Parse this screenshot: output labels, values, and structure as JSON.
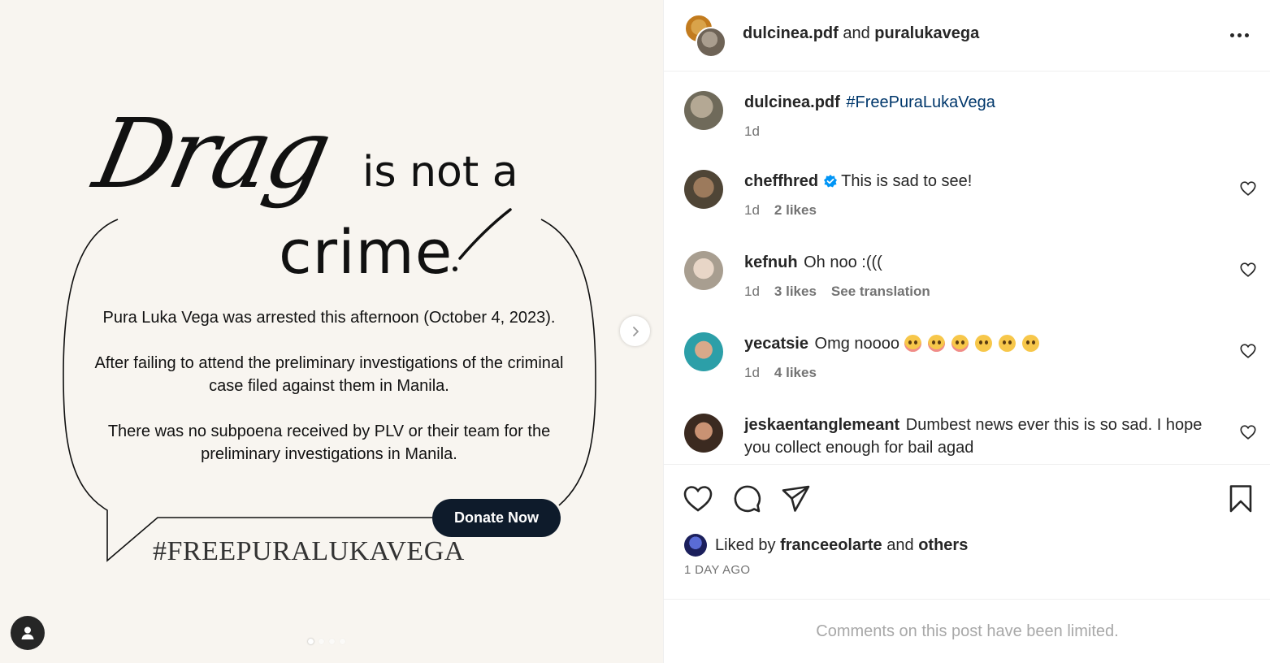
{
  "media": {
    "headline_script": "Drag",
    "headline_rest": "is not a",
    "headline_crime": "crime",
    "paragraph1": "Pura Luka Vega was arrested this afternoon (October 4, 2023).",
    "paragraph2": "After failing to attend the preliminary investigations of the criminal case filed against them in Manila.",
    "paragraph3": "There was no subpoena received by PLV or their team for the preliminary investigations in Manila.",
    "donate_label": "Donate Now",
    "hashtag": "#FREEPURALUKAVEGA",
    "carousel_total": 4,
    "carousel_active": 1
  },
  "header": {
    "user1": "dulcinea.pdf",
    "and": "and",
    "user2": "puralukavega"
  },
  "caption": {
    "user": "dulcinea.pdf",
    "text": "#FreePuraLukaVega",
    "time": "1d"
  },
  "comments": [
    {
      "user": "cheffhred",
      "verified": true,
      "text": "This is sad to see!",
      "time": "1d",
      "likes": "2 likes"
    },
    {
      "user": "kefnuh",
      "text": "Oh noo :(((",
      "time": "1d",
      "likes": "3 likes",
      "translate": "See translation"
    },
    {
      "user": "yecatsie",
      "text": "Omg noooo",
      "emoji_count": 6,
      "time": "1d",
      "likes": "4 likes"
    },
    {
      "user": "jeskaentanglemeant",
      "text": "Dumbest news ever this is so sad. I hope you collect enough for bail agad"
    }
  ],
  "actions": {
    "liked_by_prefix": "Liked by",
    "liked_by_user": "franceeolarte",
    "liked_by_and": "and",
    "liked_by_others": "others",
    "timestamp": "1 DAY AGO"
  },
  "footer": {
    "limited_text": "Comments on this post have been limited."
  },
  "colors": {
    "media_bg": "#f8f5f0",
    "donate_bg": "#0e1b2b",
    "hashtag_link": "#00376b",
    "verified": "#0095f6"
  }
}
